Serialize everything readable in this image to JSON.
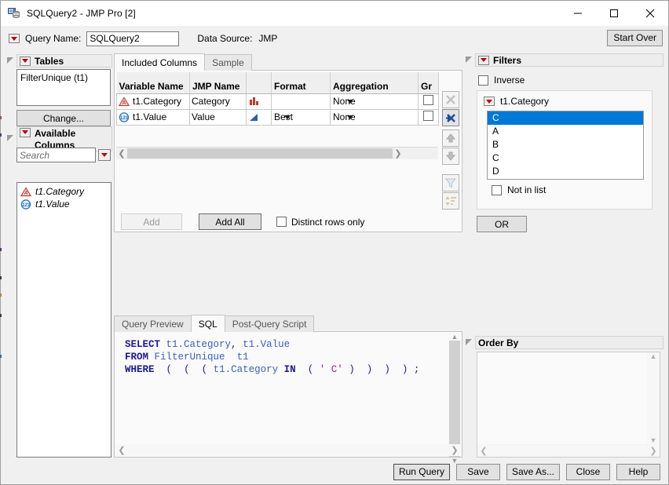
{
  "window": {
    "title": "SQLQuery2 - JMP Pro [2]",
    "icon": "database-query-icon",
    "minimize": "minimize-icon",
    "maximize": "maximize-icon",
    "close": "close-icon"
  },
  "querybar": {
    "menu_icon": "red-triangle-menu-icon",
    "query_name_label": "Query Name:",
    "query_name_value": "SQLQuery2",
    "data_source_label": "Data Source:",
    "data_source_value": "JMP",
    "start_over_label": "Start Over"
  },
  "tables_panel": {
    "title": "Tables",
    "menu_icon": "red-triangle-menu-icon",
    "items": [
      "FilterUnique (t1)"
    ],
    "change_label": "Change..."
  },
  "available_columns_panel": {
    "title_line1": "Available",
    "title_line2": "Columns",
    "menu_icon": "red-triangle-menu-icon",
    "search_placeholder": "Search",
    "search_value": "",
    "search_dropdown_icon": "red-triangle-dropdown-icon",
    "columns": [
      {
        "name": "t1.Category",
        "type_icon": "nominal-character-icon"
      },
      {
        "name": "t1.Value",
        "type_icon": "continuous-numeric-icon"
      }
    ]
  },
  "included_columns": {
    "tabs": [
      {
        "label": "Included Columns",
        "active": true
      },
      {
        "label": "Sample",
        "active": false
      }
    ],
    "headers": [
      "Variable Name",
      "JMP Name",
      "",
      "Format",
      "Aggregation",
      "Gr"
    ],
    "rows": [
      {
        "type_icon": "nominal-character-icon",
        "variable_name": "t1.Category",
        "jmp_name": "Category",
        "modeling_icon": "nominal-bar-icon",
        "format": "",
        "aggregation": "None",
        "group": false
      },
      {
        "type_icon": "continuous-numeric-icon",
        "variable_name": "t1.Value",
        "jmp_name": "Value",
        "modeling_icon": "continuous-triangle-icon",
        "format": "Best",
        "aggregation": "None",
        "group": false
      }
    ],
    "toolbar": [
      {
        "icon": "remove-x-icon",
        "state": "disabled"
      },
      {
        "icon": "remove-all-x-icon",
        "state": "pressed"
      },
      {
        "icon": "move-up-arrow-icon",
        "state": "disabled"
      },
      {
        "icon": "move-down-arrow-icon",
        "state": "disabled"
      },
      {
        "icon": "filter-funnel-icon",
        "state": "disabled"
      },
      {
        "icon": "sort-order-icon",
        "state": "disabled"
      }
    ],
    "add_label": "Add",
    "add_all_label": "Add All",
    "distinct_label": "Distinct rows only",
    "distinct_checked": false
  },
  "query_tabs": [
    {
      "label": "Query Preview",
      "active": false
    },
    {
      "label": "SQL",
      "active": true
    },
    {
      "label": "Post-Query Script",
      "active": false
    }
  ],
  "sql": {
    "lines": [
      [
        {
          "t": "SELECT",
          "c": "kw"
        },
        {
          "t": " ",
          "c": "pl"
        },
        {
          "t": "t1.Category",
          "c": "idf"
        },
        {
          "t": ", ",
          "c": "pn"
        },
        {
          "t": "t1.Value",
          "c": "idf"
        }
      ],
      [
        {
          "t": "FROM",
          "c": "kw"
        },
        {
          "t": " ",
          "c": "pl"
        },
        {
          "t": "FilterUnique",
          "c": "idf"
        },
        {
          "t": "  ",
          "c": "pl"
        },
        {
          "t": "t1",
          "c": "idf"
        }
      ],
      [
        {
          "t": "WHERE",
          "c": "kw"
        },
        {
          "t": "  ",
          "c": "pl"
        },
        {
          "t": "(",
          "c": "pn"
        },
        {
          "t": "  ",
          "c": "pl"
        },
        {
          "t": "(",
          "c": "pn"
        },
        {
          "t": "  ",
          "c": "pl"
        },
        {
          "t": "(",
          "c": "pn"
        },
        {
          "t": " ",
          "c": "pl"
        },
        {
          "t": "t1.Category",
          "c": "idf"
        },
        {
          "t": " ",
          "c": "pl"
        },
        {
          "t": "IN",
          "c": "kw"
        },
        {
          "t": "  ",
          "c": "pl"
        },
        {
          "t": "(",
          "c": "pn"
        },
        {
          "t": " ",
          "c": "pl"
        },
        {
          "t": "' C'",
          "c": "str"
        },
        {
          "t": " ",
          "c": "pl"
        },
        {
          "t": ")",
          "c": "pn"
        },
        {
          "t": "  ",
          "c": "pl"
        },
        {
          "t": ")",
          "c": "pn"
        },
        {
          "t": "  ",
          "c": "pl"
        },
        {
          "t": ")",
          "c": "pn"
        },
        {
          "t": "  ",
          "c": "pl"
        },
        {
          "t": ")",
          "c": "pn"
        },
        {
          "t": " ;",
          "c": "pn"
        }
      ]
    ],
    "plain_text": "SELECT t1.Category, t1.Value\nFROM FilterUnique  t1\nWHERE  (  (  ( t1.Category IN  ( ' C' )  )  )  ) ;"
  },
  "filters_panel": {
    "title": "Filters",
    "menu_icon": "red-triangle-menu-icon",
    "inverse_label": "Inverse",
    "inverse_checked": false,
    "filter": {
      "column_name": "t1.Category",
      "menu_icon": "red-triangle-menu-icon",
      "values": [
        {
          "label": "C",
          "selected": true
        },
        {
          "label": "A",
          "selected": false
        },
        {
          "label": "B",
          "selected": false
        },
        {
          "label": "C",
          "selected": false
        },
        {
          "label": "D",
          "selected": false
        }
      ],
      "not_in_list_label": "Not in list",
      "not_in_list_checked": false
    },
    "or_label": "OR",
    "selection_color": "#0078d7"
  },
  "order_by_panel": {
    "title": "Order By",
    "items": []
  },
  "bottom_buttons": [
    {
      "label": "Run Query",
      "name": "run-query-button",
      "default": true
    },
    {
      "label": "Save",
      "name": "save-button",
      "default": false
    },
    {
      "label": "Save As...",
      "name": "save-as-button",
      "default": false
    },
    {
      "label": "Close",
      "name": "close-button",
      "default": false
    },
    {
      "label": "Help",
      "name": "help-button",
      "default": false
    }
  ]
}
